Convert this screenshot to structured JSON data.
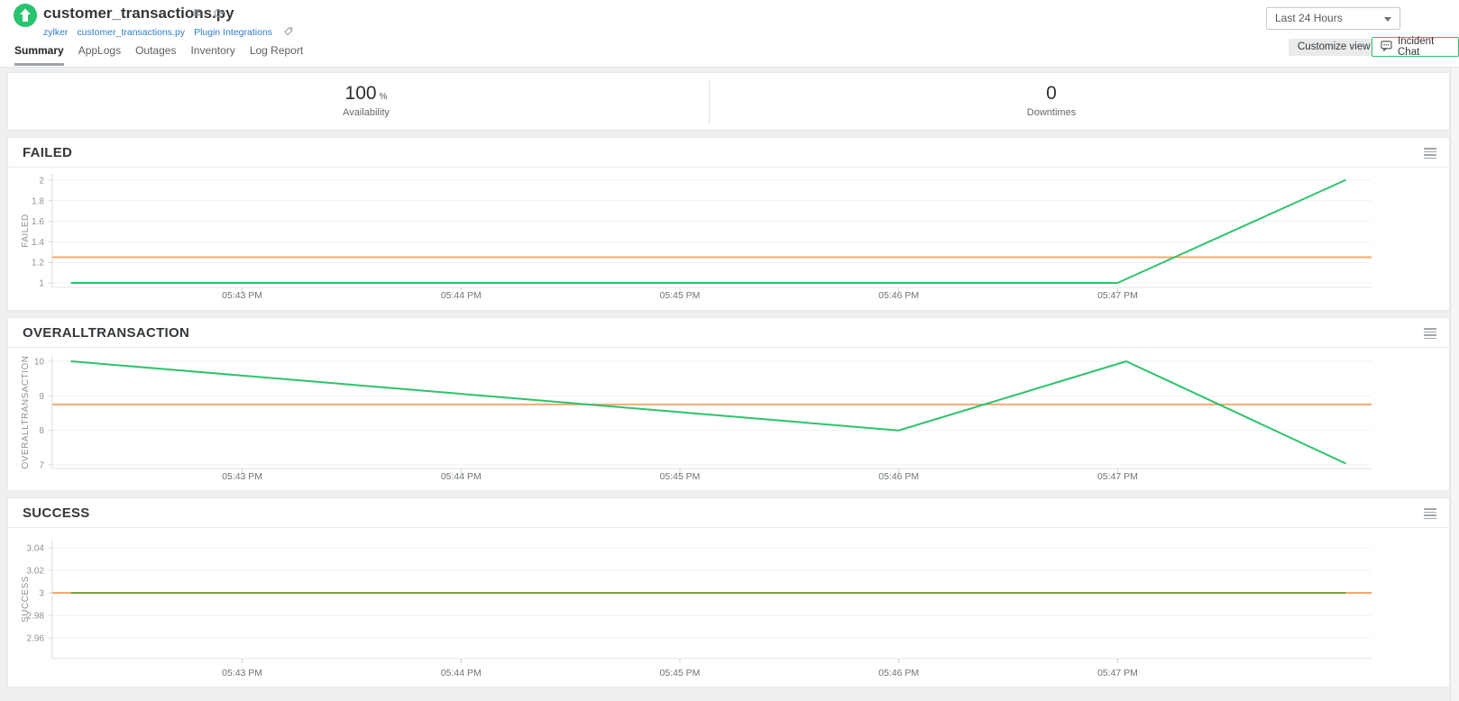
{
  "header": {
    "monitor": {
      "title": "customer_transactions.py",
      "status": "up"
    },
    "breadcrumbs": [
      {
        "label": "zylker"
      },
      {
        "label": "customer_transactions.py"
      },
      {
        "label": "Plugin Integrations"
      }
    ],
    "tabs": [
      {
        "label": "Summary",
        "active": true
      },
      {
        "label": "AppLogs",
        "active": false
      },
      {
        "label": "Outages",
        "active": false
      },
      {
        "label": "Inventory",
        "active": false
      },
      {
        "label": "Log Report",
        "active": false
      }
    ],
    "time_range": {
      "selected": "Last 24 Hours"
    },
    "buttons": {
      "customize_view": "Customize view",
      "incident_chat": "Incident Chat"
    }
  },
  "summary_stats": [
    {
      "value": "100",
      "unit": "%",
      "label": "Availability"
    },
    {
      "value": "0",
      "unit": "",
      "label": "Downtimes"
    }
  ],
  "colors": {
    "series_green": "#2dc36d",
    "threshold_orange": "#f2ab72",
    "success_overlap_olive": "#7da33f",
    "status_green": "#27c46f",
    "incident_chat_border": "#2fbe6b",
    "link_blue": "#2f7cc9"
  },
  "time_base": "05:00 PM",
  "chart_data": [
    {
      "id": "failed",
      "type": "line",
      "title": "FAILED",
      "ylabel": "FAILED",
      "y_ticks": [
        1,
        1.2,
        1.4,
        1.6,
        1.8,
        2
      ],
      "x_axis": {
        "ticks": [
          {
            "t": 43,
            "label": "05:43 PM"
          },
          {
            "t": 44,
            "label": "05:44 PM"
          },
          {
            "t": 45,
            "label": "05:45 PM"
          },
          {
            "t": 46,
            "label": "05:46 PM"
          },
          {
            "t": 47,
            "label": "05:47 PM"
          }
        ]
      },
      "threshold": {
        "value": 1.25,
        "color": "#f2ab72"
      },
      "series": [
        {
          "name": "FAILED",
          "color": "#2dc36d",
          "points": [
            [
              42.22,
              1
            ],
            [
              47.0,
              1
            ],
            [
              48.04,
              2
            ]
          ]
        }
      ]
    },
    {
      "id": "overalltransaction",
      "type": "line",
      "title": "OVERALLTRANSACTION",
      "ylabel": "OVERALLTRANSACTION",
      "y_ticks": [
        7,
        8,
        9,
        10
      ],
      "x_axis": {
        "ticks": [
          {
            "t": 43,
            "label": "05:43 PM"
          },
          {
            "t": 44,
            "label": "05:44 PM"
          },
          {
            "t": 45,
            "label": "05:45 PM"
          },
          {
            "t": 46,
            "label": "05:46 PM"
          },
          {
            "t": 47,
            "label": "05:47 PM"
          }
        ]
      },
      "threshold": {
        "value": 8.75,
        "color": "#f2ab72"
      },
      "series": [
        {
          "name": "OVERALLTRANSACTION",
          "color": "#2dc36d",
          "points": [
            [
              42.22,
              10
            ],
            [
              46.0,
              8
            ],
            [
              47.04,
              10
            ],
            [
              48.04,
              7.05
            ]
          ]
        }
      ]
    },
    {
      "id": "success",
      "type": "line",
      "title": "SUCCESS",
      "ylabel": "SUCCESS",
      "y_ticks": [
        2.96,
        2.98,
        3,
        3.02,
        3.04
      ],
      "x_axis": {
        "ticks": [
          {
            "t": 43,
            "label": "05:43 PM"
          },
          {
            "t": 44,
            "label": "05:44 PM"
          },
          {
            "t": 45,
            "label": "05:45 PM"
          },
          {
            "t": 46,
            "label": "05:46 PM"
          },
          {
            "t": 47,
            "label": "05:47 PM"
          }
        ]
      },
      "threshold": {
        "value": 3,
        "color": "#f2ab72"
      },
      "series": [
        {
          "name": "SUCCESS",
          "color": "#7da33f",
          "points": [
            [
              42.22,
              3
            ],
            [
              48.04,
              3
            ]
          ]
        }
      ]
    }
  ]
}
